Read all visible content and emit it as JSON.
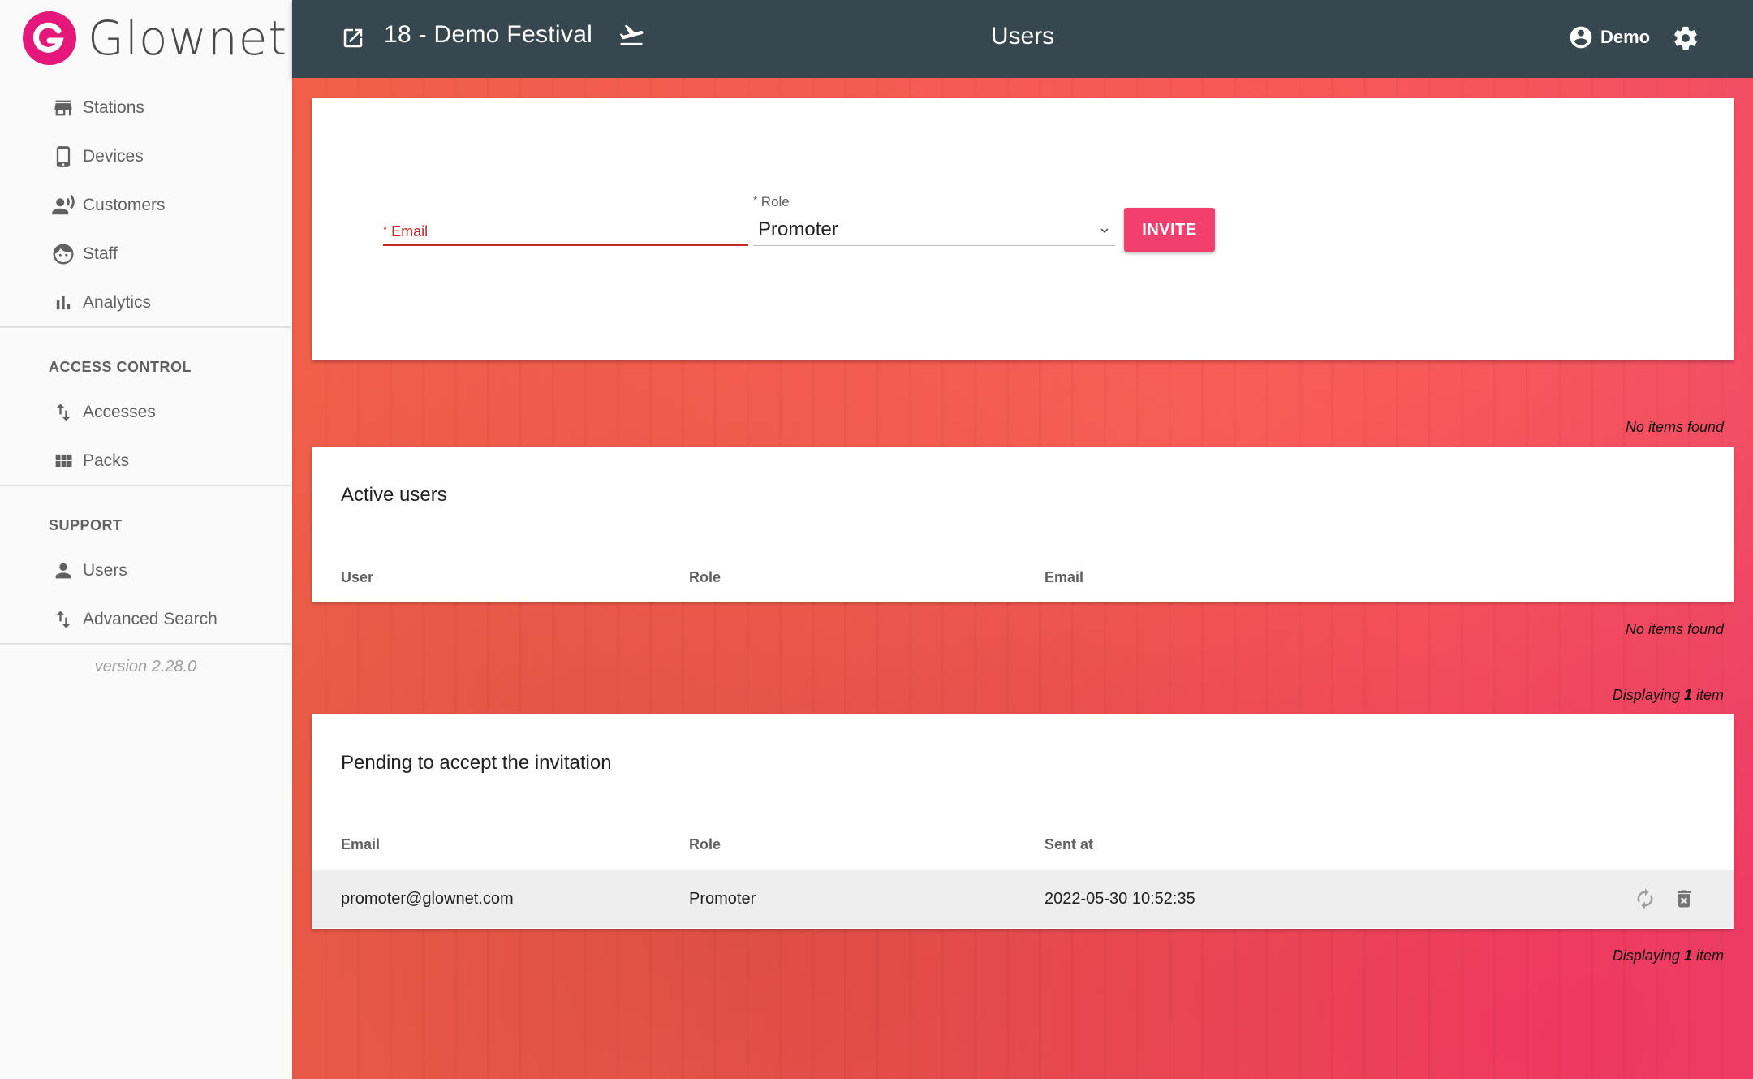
{
  "app": {
    "logo_text": "Glownet"
  },
  "sidebar": {
    "items": [
      {
        "label": "Stations",
        "icon": "store-icon"
      },
      {
        "label": "Devices",
        "icon": "phone-icon"
      },
      {
        "label": "Customers",
        "icon": "person-voice-icon"
      },
      {
        "label": "Staff",
        "icon": "face-icon"
      },
      {
        "label": "Analytics",
        "icon": "bar-chart-icon"
      }
    ],
    "sections": [
      {
        "title": "ACCESS CONTROL",
        "items": [
          {
            "label": "Accesses",
            "icon": "import-export-icon"
          },
          {
            "label": "Packs",
            "icon": "grid-icon"
          }
        ]
      },
      {
        "title": "SUPPORT",
        "items": [
          {
            "label": "Users",
            "icon": "person-icon"
          },
          {
            "label": "Advanced Search",
            "icon": "import-export-icon"
          }
        ]
      }
    ],
    "version": "version 2.28.0"
  },
  "header": {
    "event": "18 - Demo Festival",
    "title": "Users",
    "user": "Demo"
  },
  "invite_form": {
    "email_label": "Email",
    "role_label": "Role",
    "required_mark": "*",
    "role_value": "Promoter",
    "invite_label": "INVITE"
  },
  "notes": {
    "no_items_1": "No items found",
    "no_items_2": "No items found",
    "displaying_1_prefix": "Displaying",
    "displaying_1_count": "1",
    "displaying_1_suffix": "item",
    "displaying_2_prefix": "Displaying",
    "displaying_2_count": "1",
    "displaying_2_suffix": "item"
  },
  "active_users": {
    "title": "Active users",
    "columns": [
      "User",
      "Role",
      "Email"
    ]
  },
  "pending": {
    "title": "Pending to accept the invitation",
    "columns": [
      "Email",
      "Role",
      "Sent at"
    ],
    "rows": [
      {
        "email": "promoter@glownet.com",
        "role": "Promoter",
        "sent_at": "2022-05-30 10:52:35"
      }
    ]
  },
  "colors": {
    "accent": "#f23f6e",
    "header": "#37474f",
    "brand": "#e6177a",
    "error": "#c62828"
  }
}
